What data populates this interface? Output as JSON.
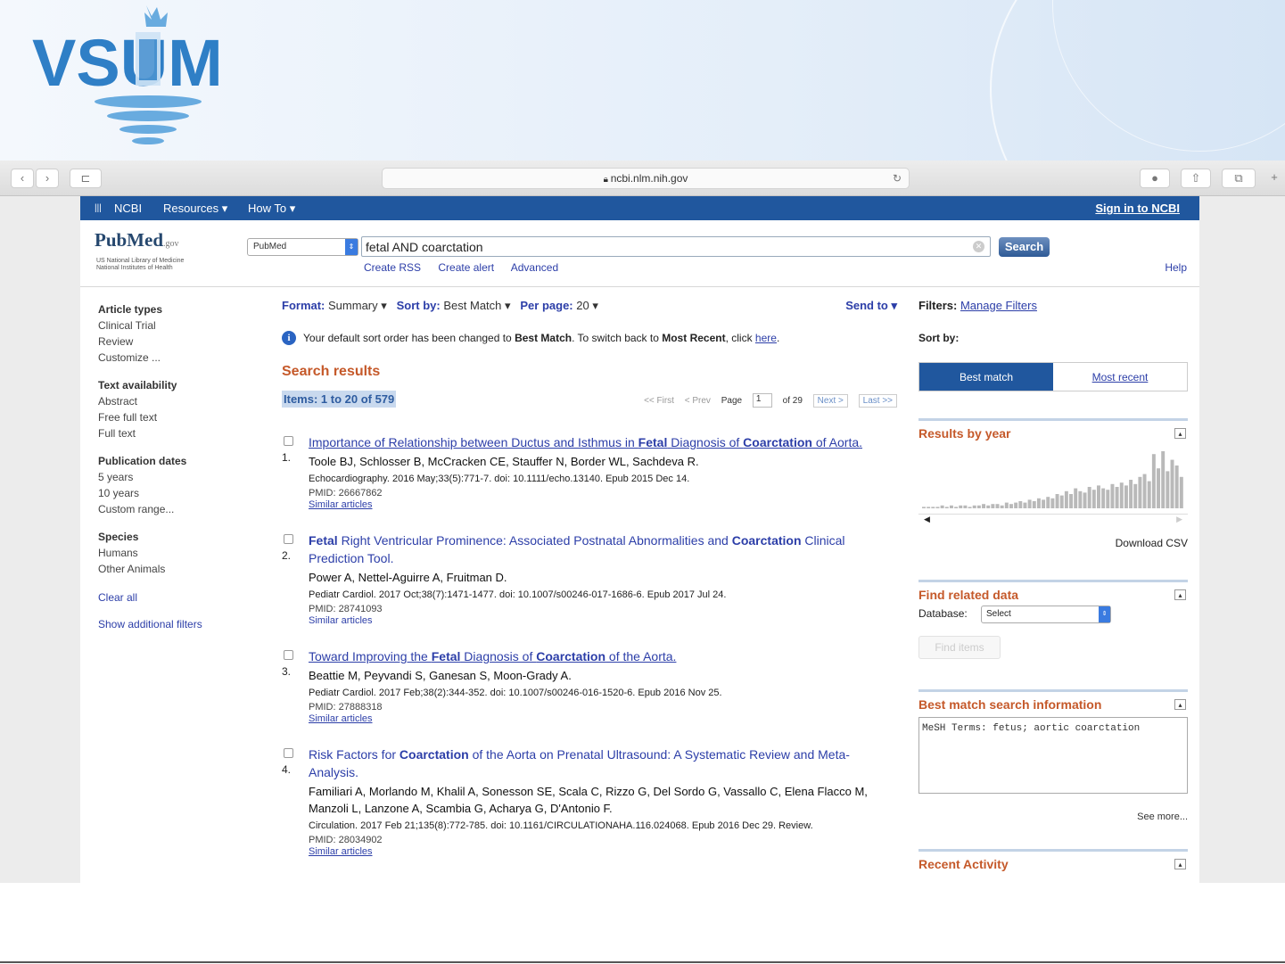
{
  "banner": {
    "logo_text": "VSUM"
  },
  "browser": {
    "url": "ncbi.nlm.nih.gov",
    "nav_back": "‹",
    "nav_forward": "›",
    "sidebar_toggle": "⊏",
    "reload": "↻",
    "new_tab": "+"
  },
  "ncbi_bar": {
    "logo": "NCBI",
    "resources": "Resources",
    "how_to": "How To",
    "sign_in": "Sign in to NCBI"
  },
  "header": {
    "pubmed_logo": "PubMed",
    "pubmed_gov": ".gov",
    "pubmed_sub1": "US National Library of Medicine",
    "pubmed_sub2": "National Institutes of Health",
    "db_select": "PubMed",
    "query": "fetal AND coarctation",
    "search_button": "Search",
    "create_rss": "Create RSS",
    "create_alert": "Create alert",
    "advanced": "Advanced",
    "help": "Help"
  },
  "filters_left": [
    {
      "heading": "Article types",
      "items": [
        "Clinical Trial",
        "Review",
        "Customize ..."
      ]
    },
    {
      "heading": "Text availability",
      "items": [
        "Abstract",
        "Free full text",
        "Full text"
      ]
    },
    {
      "heading": "Publication dates",
      "items": [
        "5 years",
        "10 years",
        "Custom range..."
      ]
    },
    {
      "heading": "Species",
      "items": [
        "Humans",
        "Other Animals"
      ]
    }
  ],
  "left_links": {
    "clear_all": "Clear all",
    "show_additional": "Show additional filters"
  },
  "display": {
    "format_label": "Format:",
    "format_value": "Summary",
    "sort_label": "Sort by:",
    "sort_value": "Best Match",
    "perpage_label": "Per page:",
    "perpage_value": "20",
    "send_to": "Send to"
  },
  "notice": {
    "text1": "Your default sort order has been changed to ",
    "bold1": "Best Match",
    "text2": ". To switch back to ",
    "bold2": "Most Recent",
    "text3": ", click ",
    "link": "here"
  },
  "results": {
    "heading": "Search results",
    "items_count": "Items: 1 to 20 of 579",
    "pager": {
      "first": "<< First",
      "prev": "< Prev",
      "page_label": "Page",
      "page_value": "1",
      "of": "of 29",
      "next": "Next >",
      "last": "Last >>"
    },
    "entries": [
      {
        "num": "1.",
        "title_parts": [
          "Importance of Relationship between Ductus and Isthmus in ",
          "Fetal",
          " Diagnosis of ",
          "Coarctation",
          " of Aorta."
        ],
        "authors": "Toole BJ, Schlosser B, McCracken CE, Stauffer N, Border WL, Sachdeva R.",
        "journal": "Echocardiography. 2016 May;33(5):771-7. doi: 10.1111/echo.13140. Epub 2015 Dec 14.",
        "pmid": "PMID: 26667862",
        "similar": "Similar articles"
      },
      {
        "num": "2.",
        "title_parts": [
          "Fetal",
          " Right Ventricular Prominence: Associated Postnatal Abnormalities and ",
          "Coarctation",
          " Clinical Prediction Tool."
        ],
        "authors": "Power A, Nettel-Aguirre A, Fruitman D.",
        "journal": "Pediatr Cardiol. 2017 Oct;38(7):1471-1477. doi: 10.1007/s00246-017-1686-6. Epub 2017 Jul 24.",
        "pmid": "PMID: 28741093",
        "similar": "Similar articles"
      },
      {
        "num": "3.",
        "title_parts": [
          "Toward Improving the ",
          "Fetal",
          " Diagnosis of ",
          "Coarctation",
          " of the Aorta."
        ],
        "authors": "Beattie M, Peyvandi S, Ganesan S, Moon-Grady A.",
        "journal": "Pediatr Cardiol. 2017 Feb;38(2):344-352. doi: 10.1007/s00246-016-1520-6. Epub 2016 Nov 25.",
        "pmid": "PMID: 27888318",
        "similar": "Similar articles"
      },
      {
        "num": "4.",
        "title_parts": [
          "Risk Factors for ",
          "Coarctation",
          " of the Aorta on Prenatal Ultrasound: A Systematic Review and Meta-Analysis."
        ],
        "authors": "Familiari A, Morlando M, Khalil A, Sonesson SE, Scala C, Rizzo G, Del Sordo G, Vassallo C, Elena Flacco M, Manzoli L, Lanzone A, Scambia G, Acharya G, D'Antonio F.",
        "journal": "Circulation. 2017 Feb 21;135(8):772-785. doi: 10.1161/CIRCULATIONAHA.116.024068. Epub 2016 Dec 29. Review.",
        "pmid": "PMID: 28034902",
        "similar": "Similar articles"
      }
    ]
  },
  "right": {
    "filters_label": "Filters:",
    "manage_filters": "Manage Filters",
    "sort_by": "Sort by:",
    "best_match": "Best match",
    "most_recent": "Most recent",
    "results_by_year": "Results by year",
    "download_csv": "Download CSV",
    "find_related": "Find related data",
    "database_label": "Database:",
    "database_value": "Select",
    "find_items": "Find items",
    "best_match_info": "Best match search information",
    "mesh_terms": "MeSH Terms: fetus; aortic coarctation",
    "see_more": "See more...",
    "recent_activity": "Recent Activity"
  },
  "chart_data": {
    "type": "bar",
    "title": "Results by year",
    "values": [
      1,
      1,
      1,
      1,
      2,
      1,
      2,
      1,
      2,
      2,
      1,
      2,
      2,
      3,
      2,
      3,
      3,
      2,
      4,
      3,
      4,
      5,
      4,
      6,
      5,
      7,
      6,
      8,
      7,
      10,
      9,
      12,
      10,
      14,
      12,
      11,
      15,
      13,
      16,
      14,
      13,
      17,
      15,
      18,
      16,
      20,
      17,
      22,
      24,
      19,
      38,
      28,
      40,
      26,
      34,
      30,
      22
    ]
  }
}
